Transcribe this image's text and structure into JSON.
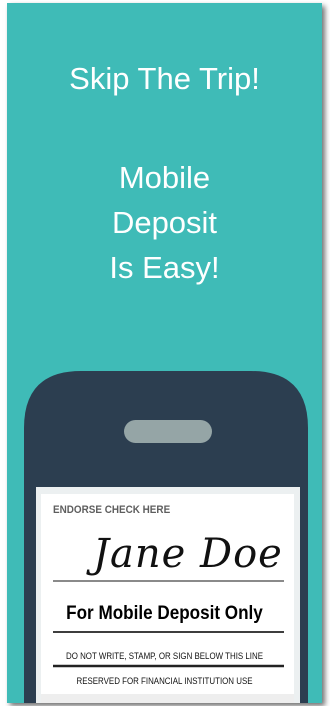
{
  "ad": {
    "headline": "Skip The Trip!",
    "subline": [
      "Mobile",
      "Deposit",
      "Is Easy!"
    ],
    "colors": {
      "background": "#3fbbb7",
      "phone_body": "#2c3e50",
      "speaker": "#95a5a6",
      "screen": "#ecf0f1",
      "check": "#ffffff"
    }
  },
  "check": {
    "endorse_label": "ENDORSE CHECK HERE",
    "signature": "Jane Doe",
    "mobile_deposit": "For Mobile Deposit Only",
    "do_not_write": "DO NOT WRITE, STAMP, OR SIGN BELOW THIS LINE",
    "reserved": "RESERVED FOR FINANCIAL INSTITUTION USE"
  }
}
